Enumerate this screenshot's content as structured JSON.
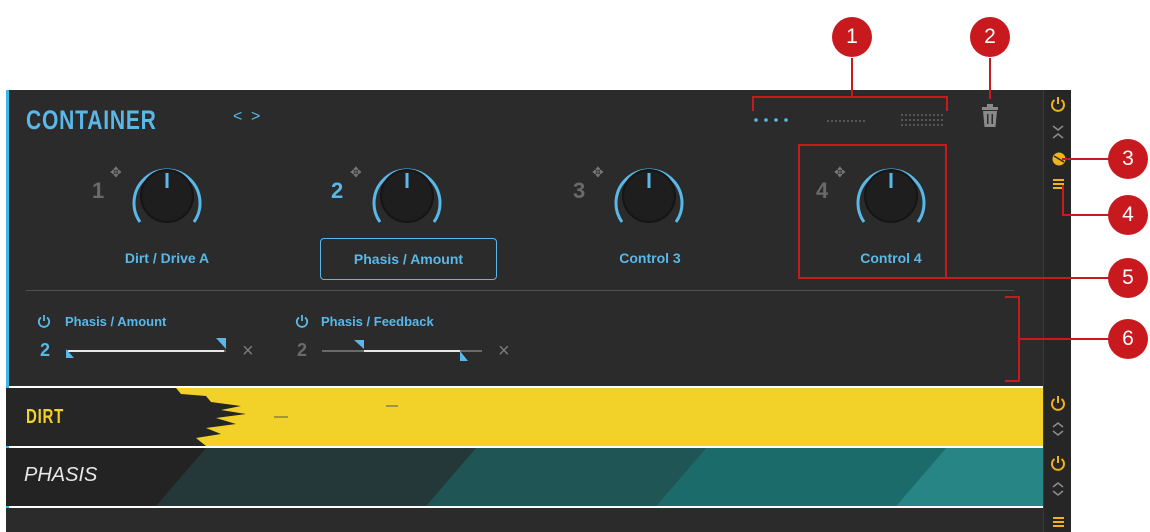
{
  "header": {
    "title": "CONTAINER",
    "nav_prev": "<",
    "nav_next": ">"
  },
  "layout_selector": {
    "options": [
      "small",
      "medium",
      "large"
    ],
    "selected": "small"
  },
  "macros": [
    {
      "number": "1",
      "label": "Dirt / Drive A",
      "framed": false,
      "active": false
    },
    {
      "number": "2",
      "label": "Phasis / Amount",
      "framed": true,
      "active": true
    },
    {
      "number": "3",
      "label": "Control 3",
      "framed": false,
      "active": false
    },
    {
      "number": "4",
      "label": "Control 4",
      "framed": false,
      "active": false
    }
  ],
  "assignments": [
    {
      "title": "Phasis / Amount",
      "macro": "2",
      "range_start": 0.0,
      "range_end": 1.0,
      "active": true
    },
    {
      "title": "Phasis / Feedback",
      "macro": "2",
      "range_start": 0.28,
      "range_end": 0.85,
      "active": false
    }
  ],
  "remove_symbol": "×",
  "rows": [
    {
      "name": "DIRT",
      "color": "#f2d228"
    },
    {
      "name": "PHASIS",
      "color": "#1f8a86"
    }
  ],
  "callouts": [
    "1",
    "2",
    "3",
    "4",
    "5",
    "6"
  ],
  "colors": {
    "accent": "#5ab8e8",
    "callout": "#c8191f",
    "sidebar_icon": "#f2b21b",
    "panel": "#2b2b2b"
  },
  "icons": {
    "power": "power-icon",
    "delete": "trash-icon",
    "collapse": "collapse-chevrons-icon",
    "expand": "expand-chevrons-icon",
    "color_picker": "color-picker-icon",
    "menu": "menu-icon",
    "move": "move-icon"
  }
}
